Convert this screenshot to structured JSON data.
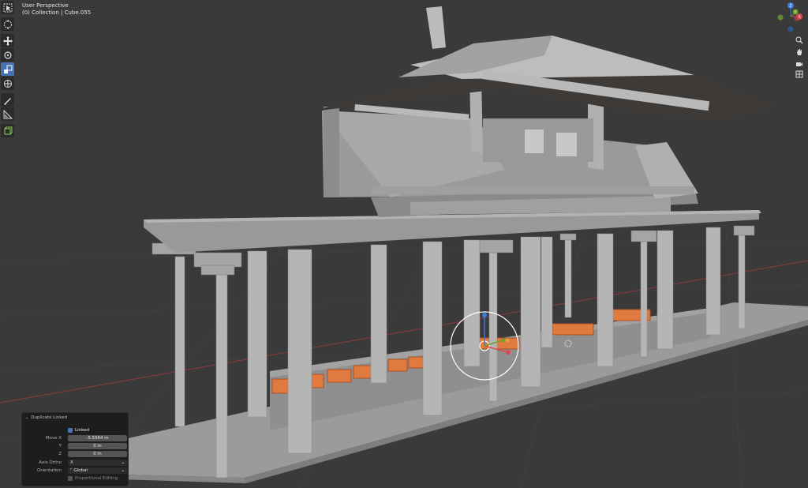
{
  "viewport": {
    "mode": "User Perspective",
    "collection": "(0) Collection | Cube.055"
  },
  "toolbar": {
    "tools": [
      {
        "name": "select-box-icon",
        "active": false
      },
      {
        "name": "cursor-icon",
        "active": false
      },
      {
        "name": "move-icon",
        "active": false
      },
      {
        "name": "rotate-icon",
        "active": false
      },
      {
        "name": "scale-icon",
        "active": true
      },
      {
        "name": "transform-icon",
        "active": false
      },
      {
        "name": "annotate-icon",
        "active": false
      },
      {
        "name": "measure-icon",
        "active": false
      },
      {
        "name": "add-cube-icon",
        "active": false
      }
    ]
  },
  "nav_gizmo": {
    "x_label": "X",
    "y_label": "Y",
    "z_label": "Z",
    "colors": {
      "x": "#e0464f",
      "y": "#6fa127",
      "z": "#3c7bd9"
    }
  },
  "nav_buttons": [
    "zoom-icon",
    "hand-icon",
    "camera-icon",
    "grid-icon"
  ],
  "operator_panel": {
    "title": "Duplicate Linked",
    "linked_label": "Linked",
    "linked_checked": true,
    "move_x_label": "Move X",
    "move_x_value": "-5.5964 m",
    "y_label": "Y",
    "y_value": "0 m",
    "z_label": "Z",
    "z_value": "0 m",
    "axis_ortho_label": "Axis Ortho",
    "axis_ortho_value": "X",
    "orientation_label": "Orientation",
    "orientation_value": "Global",
    "proportional_label": "Proportional Editing",
    "proportional_checked": false
  },
  "colors": {
    "background": "#3a3a3a",
    "model": "#a8a8a8",
    "selection": "#e0773a",
    "active_tool": "#4772b3"
  }
}
